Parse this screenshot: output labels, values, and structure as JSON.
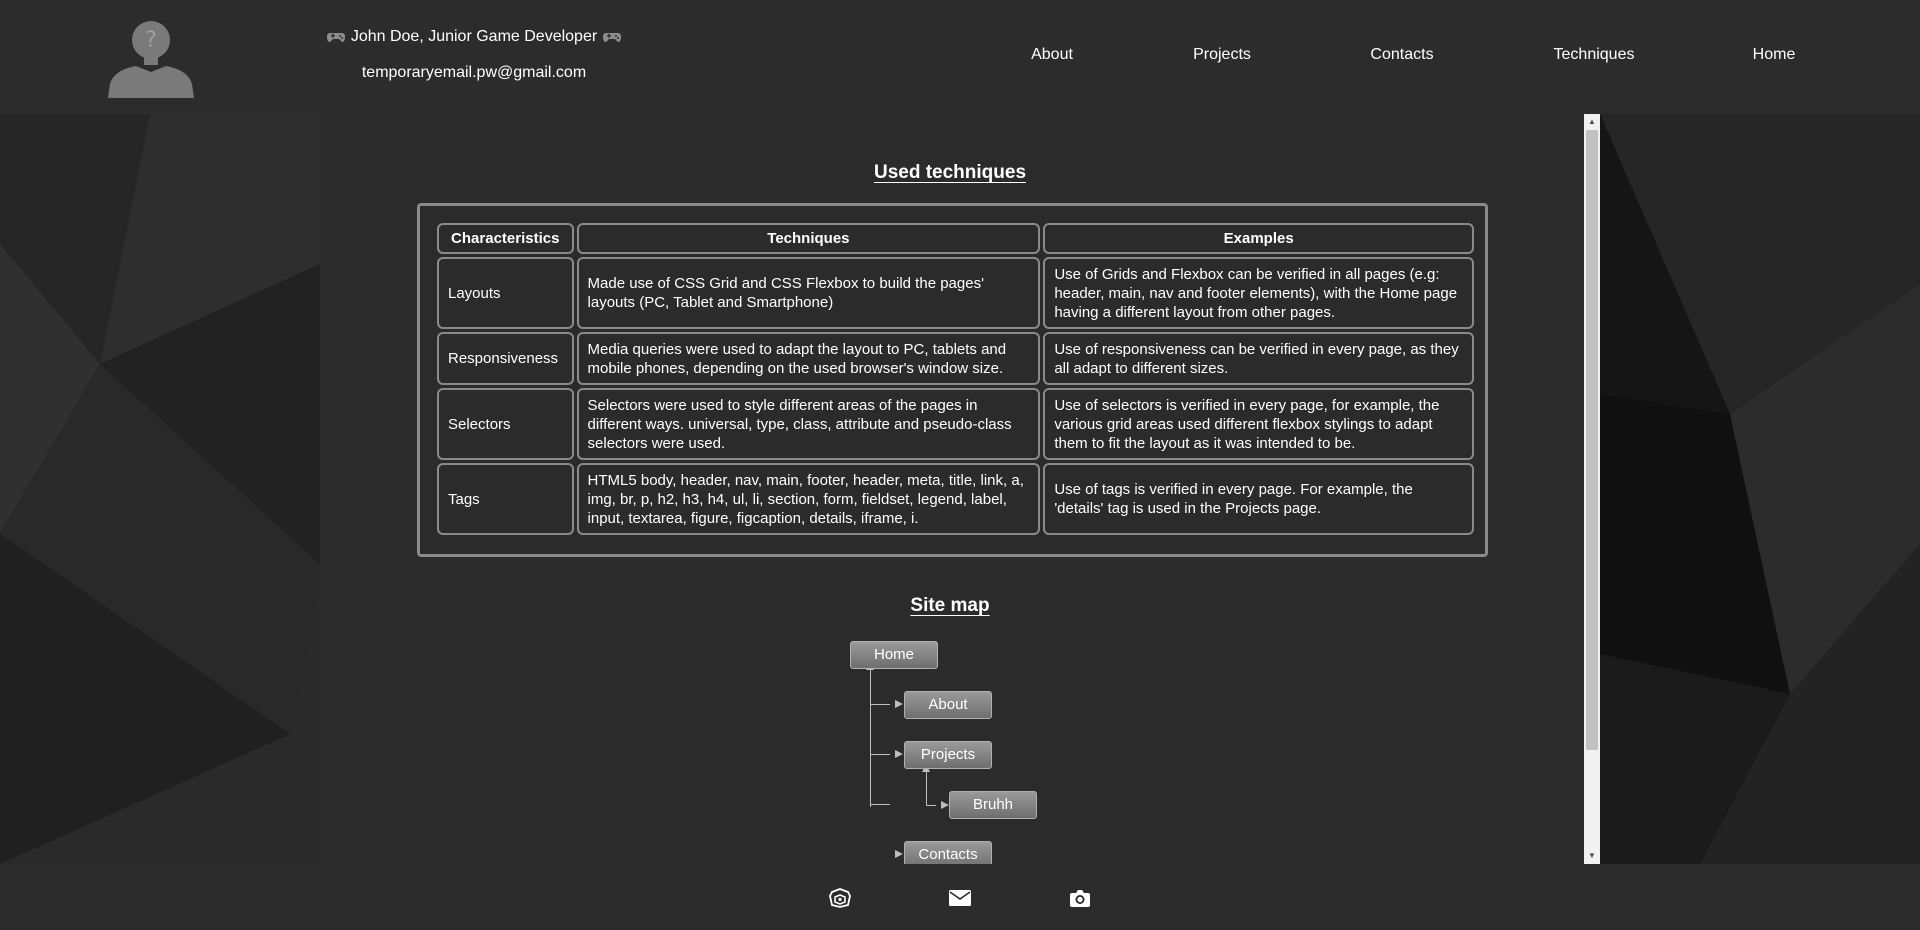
{
  "header": {
    "name": "John Doe, Junior Game Developer",
    "name_icon_left": "gamepad-icon",
    "name_icon_right": "gamepad-icon",
    "email": "temporaryemail.pw@gmail.com",
    "avatar_icon": "unknown-user-avatar",
    "avatar_glyph": "?"
  },
  "nav": {
    "items": [
      {
        "label": "About"
      },
      {
        "label": "Projects"
      },
      {
        "label": "Contacts"
      },
      {
        "label": "Techniques"
      },
      {
        "label": "Home"
      }
    ]
  },
  "techniques": {
    "title": "Used techniques",
    "headers": [
      "Characteristics",
      "Techniques",
      "Examples"
    ],
    "rows": [
      {
        "characteristic": "Layouts",
        "technique": "Made use of CSS Grid and CSS Flexbox to build the pages' layouts (PC, Tablet and Smartphone)",
        "example": "Use of Grids and Flexbox can be verified in all pages (e.g: header, main, nav and footer elements), with the Home page having a different layout from other pages."
      },
      {
        "characteristic": "Responsiveness",
        "technique": "Media queries were used to adapt the layout to PC, tablets and mobile phones, depending on the used browser's window size.",
        "example": "Use of responsiveness can be verified in every page, as they all adapt to different sizes."
      },
      {
        "characteristic": "Selectors",
        "technique": "Selectors were used to style different areas of the pages in different ways. universal, type, class, attribute and pseudo-class selectors were used.",
        "example": "Use of selectors is verified in every page, for example, the various grid areas used different flexbox stylings to adapt them to fit the layout as it was intended to be."
      },
      {
        "characteristic": "Tags",
        "technique": "HTML5 body, header, nav, main, footer, header, meta, title, link, a, img, br, p, h2, h3, h4, ul, li, section, form, fieldset, legend, label, input, textarea, figure, figcaption, details, iframe, i.",
        "example": "Use of tags is verified in every page. For example, the 'details' tag is used in the Projects page."
      }
    ]
  },
  "sitemap": {
    "title": "Site map",
    "nodes": [
      "Home",
      "About",
      "Projects",
      "Bruhh",
      "Contacts"
    ]
  },
  "footer": {
    "icons": [
      "itch-io-icon",
      "mail-icon",
      "camera-icon"
    ]
  },
  "colors": {
    "header_bg": "#2c2c2c",
    "main_bg": "#2b2b2b",
    "border": "#8a8a8a",
    "text": "#ffffff"
  }
}
